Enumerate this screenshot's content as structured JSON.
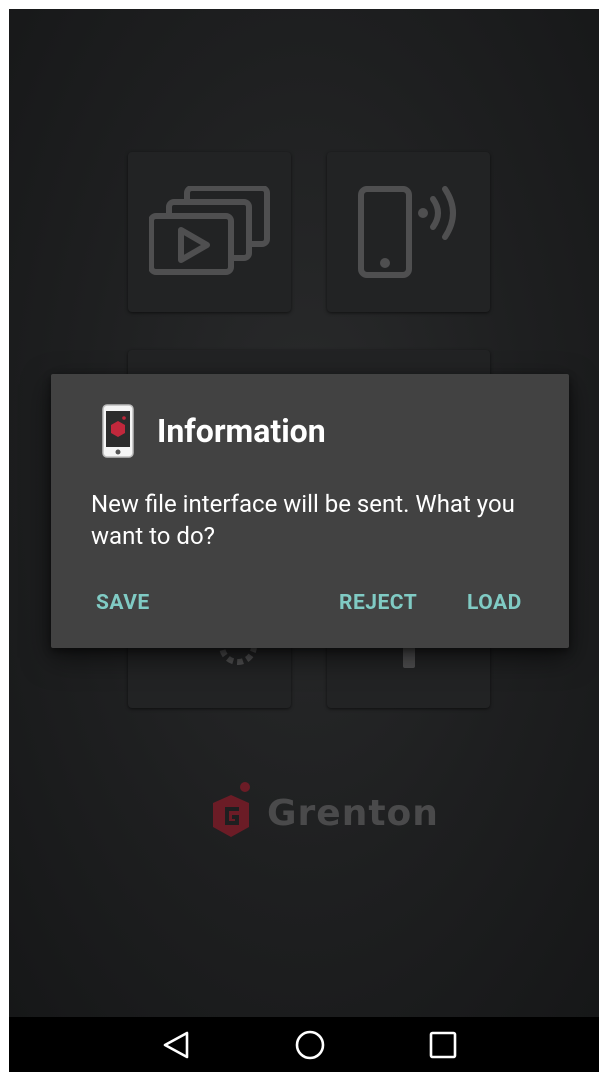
{
  "dialog": {
    "title": "Information",
    "message": "New file interface will be sent. What you want to do?",
    "buttons": {
      "save": "SAVE",
      "reject": "REJECT",
      "load": "LOAD"
    },
    "accent_color": "#80cbc4",
    "icon": "phone-app-icon"
  },
  "brand": {
    "name": "Grenton",
    "logo_color": "#6b1c26",
    "icon": "grenton-logo-icon"
  },
  "tiles": [
    {
      "icon": "media-gallery-icon"
    },
    {
      "icon": "phone-wireless-icon"
    },
    {
      "icon": "settings-icon"
    },
    {
      "icon": "remote-icon"
    }
  ],
  "navbar": {
    "back_icon": "back-triangle-icon",
    "home_icon": "home-circle-icon",
    "recents_icon": "recents-square-icon"
  }
}
